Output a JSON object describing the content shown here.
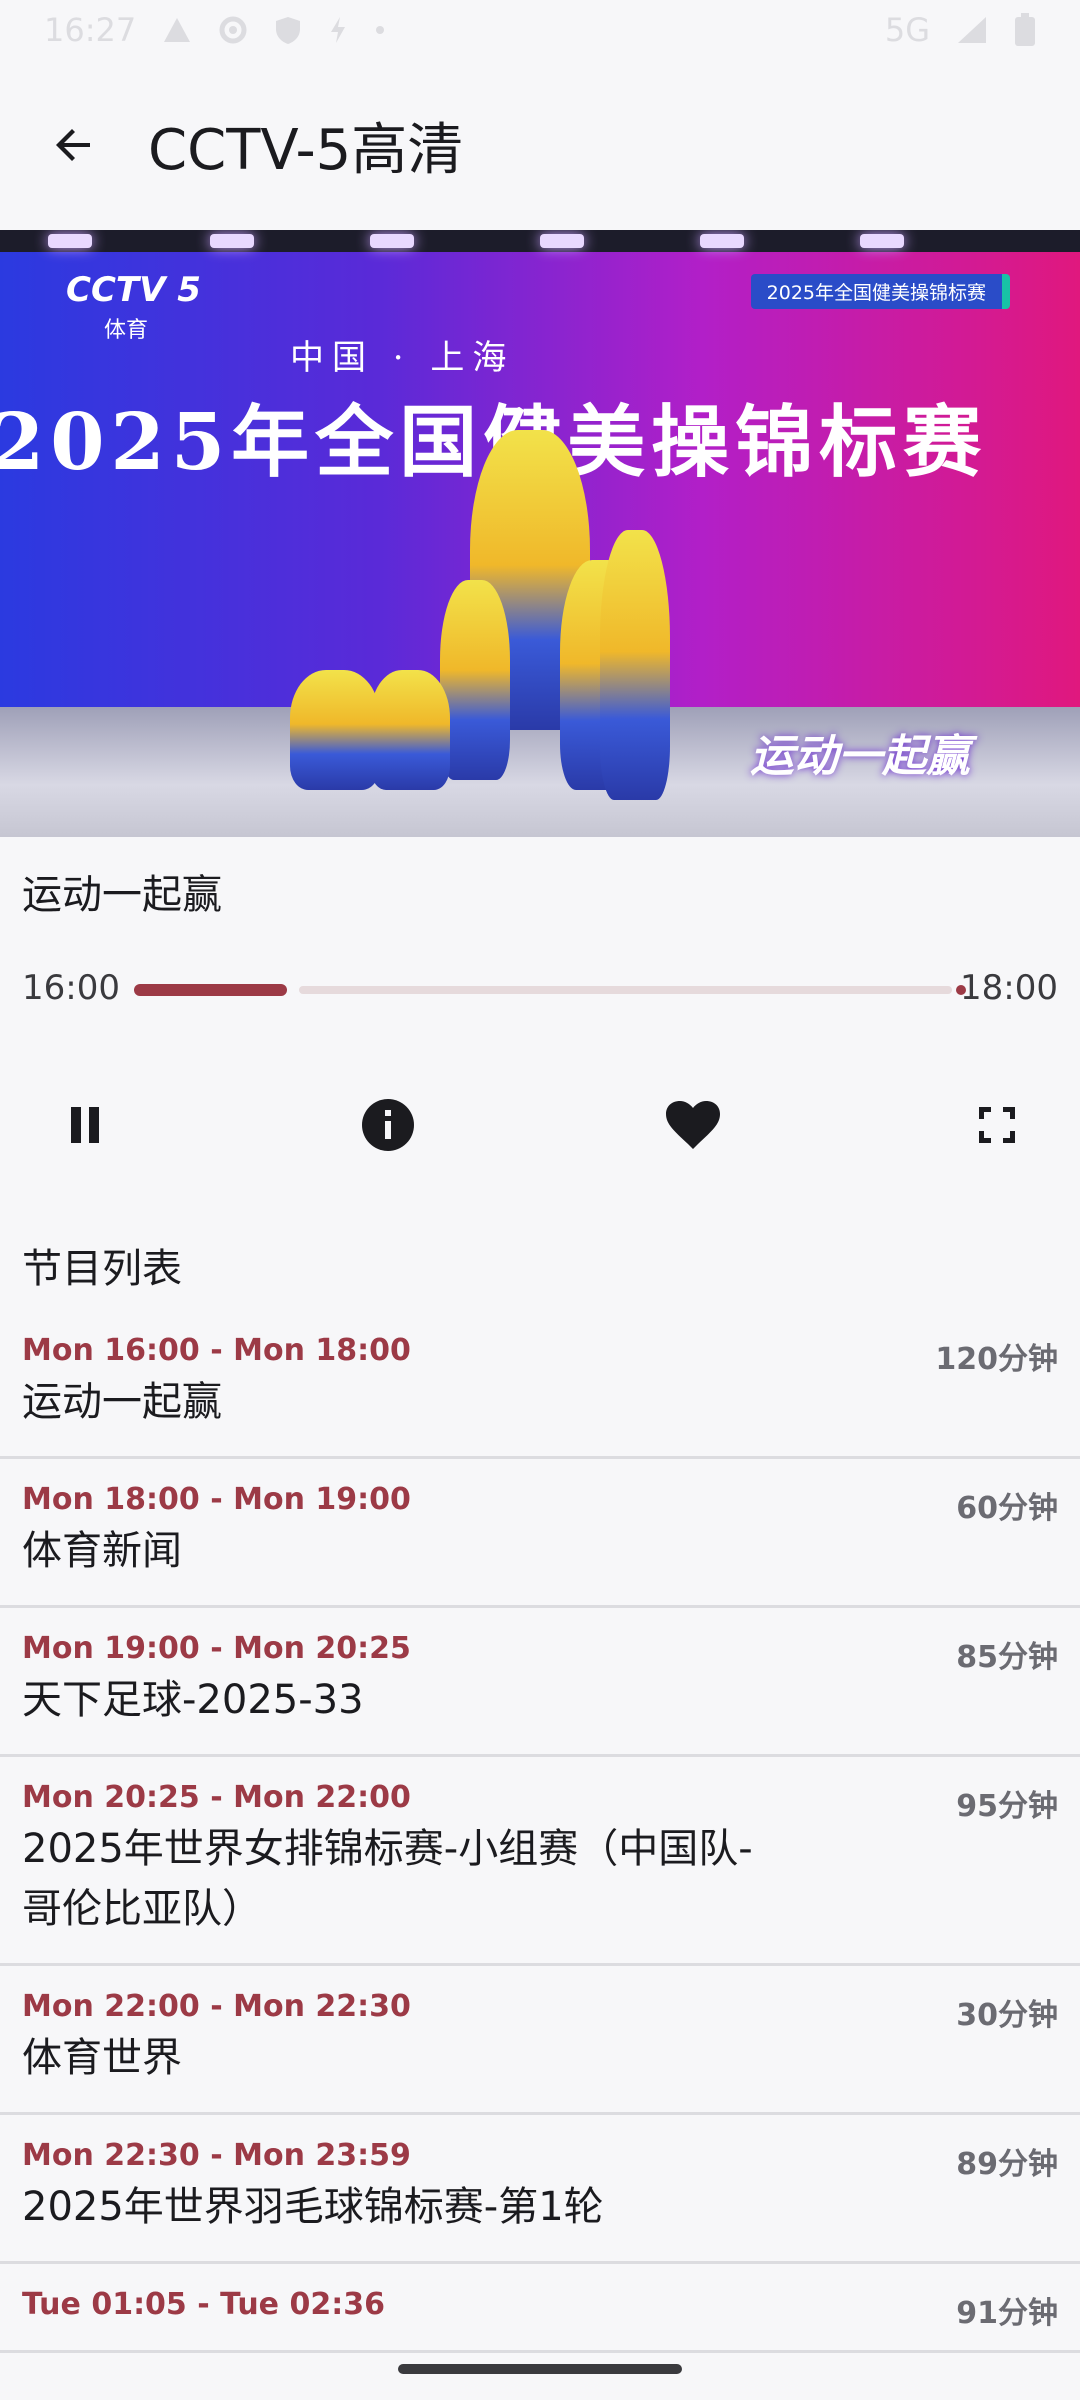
{
  "status_bar": {
    "time": "16:27",
    "network": "5G",
    "icons": [
      "warning-icon",
      "settings-icon",
      "shield-icon",
      "flash-icon",
      "dot-icon",
      "signal-icon",
      "battery-icon"
    ]
  },
  "app_bar": {
    "back_icon": "arrow-left-icon",
    "title": "CCTV-5高清"
  },
  "video": {
    "channel_logo": "CCTV 5",
    "channel_logo_sub": "体育",
    "event_badge": "2025年全国健美操锦标赛",
    "banner_sub": "中国 · 上海",
    "banner_title": "2025年全国健美操锦标赛",
    "slogan": "运动一起赢"
  },
  "now_playing": {
    "title": "运动一起赢",
    "start": "16:00",
    "end": "18:00",
    "progress": 0.23
  },
  "controls": {
    "pause_icon": "pause-icon",
    "info_icon": "info-icon",
    "favorite_icon": "heart-icon",
    "fullscreen_icon": "fullscreen-icon"
  },
  "schedule": {
    "title": "节目列表",
    "items": [
      {
        "time": "Mon 16:00 - Mon 18:00",
        "title": "运动一起赢",
        "duration": "120分钟"
      },
      {
        "time": "Mon 18:00 - Mon 19:00",
        "title": "体育新闻",
        "duration": "60分钟"
      },
      {
        "time": "Mon 19:00 - Mon 20:25",
        "title": "天下足球-2025-33",
        "duration": "85分钟"
      },
      {
        "time": "Mon 20:25 - Mon 22:00",
        "title": "2025年世界女排锦标赛-小组赛（中国队-哥伦比亚队）",
        "duration": "95分钟"
      },
      {
        "time": "Mon 22:00 - Mon 22:30",
        "title": "体育世界",
        "duration": "30分钟"
      },
      {
        "time": "Mon 22:30 - Mon 23:59",
        "title": "2025年世界羽毛球锦标赛-第1轮",
        "duration": "89分钟"
      },
      {
        "time": "Tue 01:05 - Tue 02:36",
        "title": "",
        "duration": "91分钟"
      }
    ]
  },
  "colors": {
    "accent": "#9c3a46",
    "background": "#f7f7f9"
  }
}
